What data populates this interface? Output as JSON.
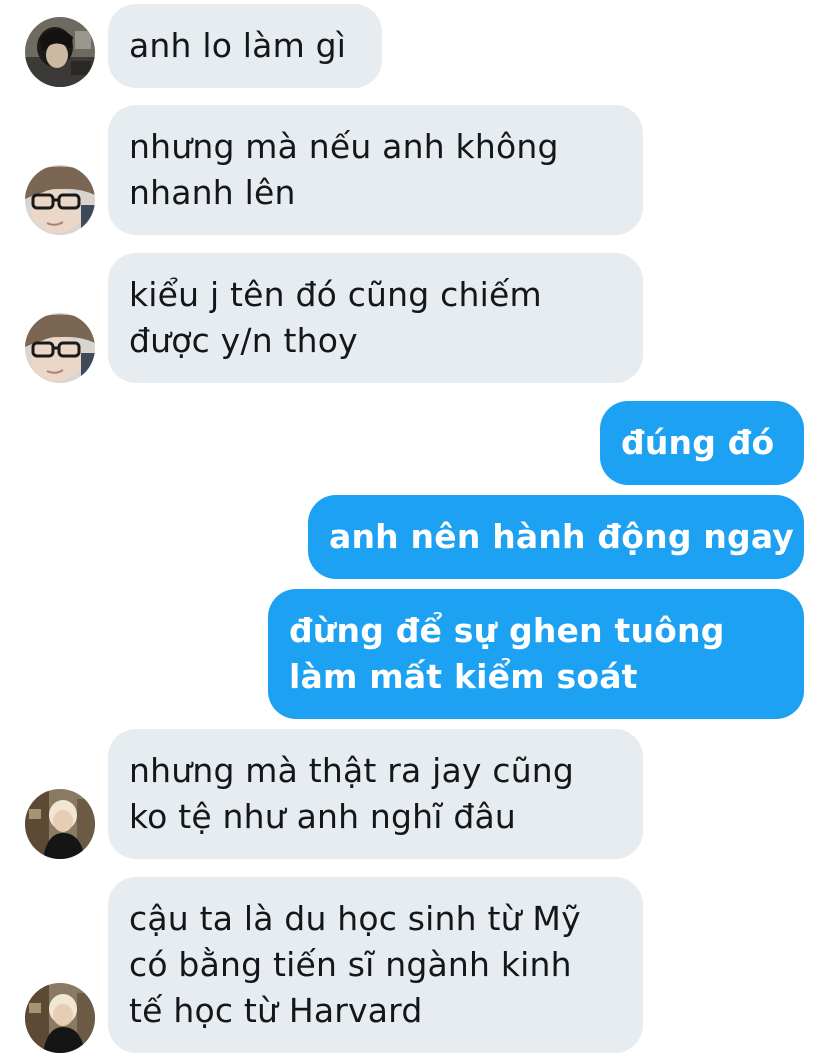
{
  "messages": [
    {
      "side": "in",
      "avatar": "avatar-dark-hair",
      "lines": [
        "anh lo làm gì"
      ]
    },
    {
      "side": "in",
      "avatar": "avatar-glasses",
      "lines": [
        "nhưng mà nếu anh không",
        "nhanh lên"
      ]
    },
    {
      "side": "in",
      "avatar": "avatar-glasses",
      "lines": [
        "kiểu j tên đó cũng chiếm",
        "được y/n thoy"
      ]
    },
    {
      "side": "out",
      "lines": [
        "đúng đó"
      ]
    },
    {
      "side": "out",
      "lines": [
        "anh nên hành động ngay"
      ]
    },
    {
      "side": "out",
      "lines": [
        "đừng để sự ghen tuông",
        "làm mất kiểm soát"
      ]
    },
    {
      "side": "in",
      "avatar": "avatar-blonde",
      "lines": [
        "nhưng mà thật ra jay cũng",
        "ko tệ như anh nghĩ đâu"
      ]
    },
    {
      "side": "in",
      "avatar": "avatar-blonde",
      "lines": [
        "cậu ta là du học sinh từ Mỹ",
        "có bằng tiến sĩ ngành kinh",
        "tế học từ Harvard"
      ]
    }
  ],
  "colors": {
    "incoming_bubble": "#e6ecf0",
    "incoming_text": "#14171a",
    "outgoing_bubble": "#1da1f2",
    "outgoing_text": "#ffffff"
  }
}
